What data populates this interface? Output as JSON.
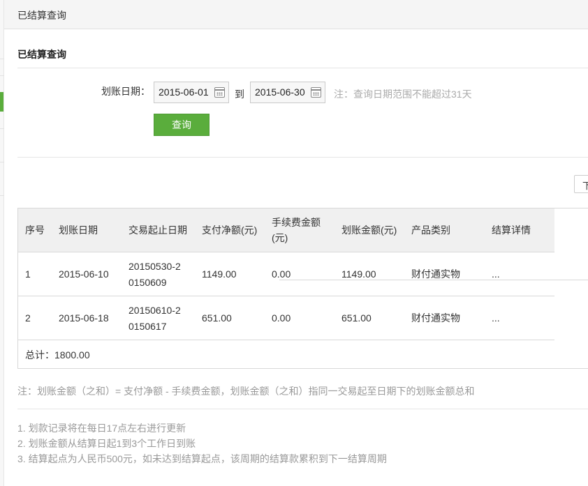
{
  "header": {
    "title": "已结算查询"
  },
  "section": {
    "title": "已结算查询"
  },
  "filter": {
    "date_label": "划账日期：",
    "start_date": "2015-06-01",
    "to_label": "到",
    "end_date": "2015-06-30",
    "note": "注：查询日期范围不能超过31天",
    "query_button": "查询"
  },
  "pagination": {
    "control_text": "下"
  },
  "table": {
    "headers": [
      "序号",
      "划账日期",
      "交易起止日期",
      "支付净额(元)",
      "手续费金额(元)",
      "划账金额(元)",
      "产品类别",
      "结算详情"
    ],
    "rows": [
      {
        "index": "1",
        "transfer_date": "2015-06-10",
        "trade_range_1": "20150530-2",
        "trade_range_2": "0150609",
        "net_amount": "1149.00",
        "fee": "0.00",
        "transfer_amount": "1149.00",
        "product": "财付通实物",
        "detail": "..."
      },
      {
        "index": "2",
        "transfer_date": "2015-06-18",
        "trade_range_1": "20150610-2",
        "trade_range_2": "0150617",
        "net_amount": "651.00",
        "fee": "0.00",
        "transfer_amount": "651.00",
        "product": "财付通实物",
        "detail": "..."
      }
    ],
    "total": "总计：1800.00"
  },
  "footnote": "注：划账金额（之和）= 支付净额 - 手续费金额，划账金额（之和）指同一交易起至日期下的划账金额总和",
  "tips": [
    "1. 划款记录将在每日17点左右进行更新",
    "2. 划账金额从结算日起1到3个工作日到账",
    "3. 结算起点为人民币500元，如未达到结算起点，该周期的结算款累积到下一结算周期"
  ]
}
